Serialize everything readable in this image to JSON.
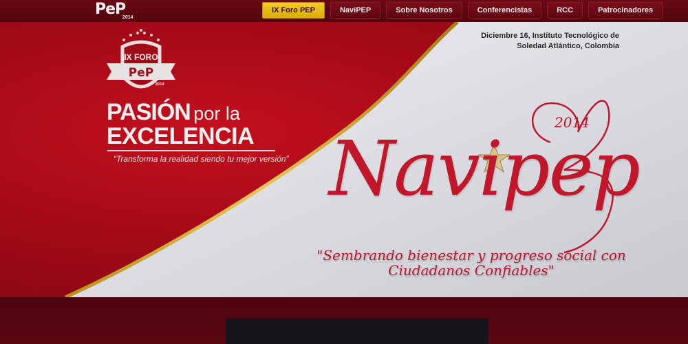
{
  "header": {
    "logo": {
      "text": "PeP",
      "year": "2014"
    },
    "nav": [
      {
        "label": "IX Foro PEP",
        "active": true
      },
      {
        "label": "NaviPEP",
        "active": false
      },
      {
        "label": "Sobre Nosotros",
        "active": false
      },
      {
        "label": "Conferencistas",
        "active": false
      },
      {
        "label": "RCC",
        "active": false
      },
      {
        "label": "Patrocinadores",
        "active": false
      }
    ]
  },
  "hero": {
    "event_info": {
      "line1": "Diciembre 16, Instituto Tecnológico de",
      "line2": "Soledad Atlántico, Colombia"
    },
    "badge": {
      "line1": "IX FORO",
      "line2": "PeP",
      "year": "2014"
    },
    "pasion": {
      "word1": "PASIÓN",
      "word2": "por la",
      "word3": "EXCELENCIA",
      "tagline": "“Transforma la realidad siendo tu mejor versión”"
    },
    "navipep": {
      "title": "Navipep",
      "year": "2014",
      "slogan_line1": "\"Sembrando bienestar y progreso social con",
      "slogan_line2": "Ciudadanos Confiables\""
    }
  },
  "colors": {
    "brand_red": "#b0101d",
    "nav_active": "#f4cd22",
    "gold_swoosh": "#c9a42a",
    "script_red": "#c0172b"
  }
}
